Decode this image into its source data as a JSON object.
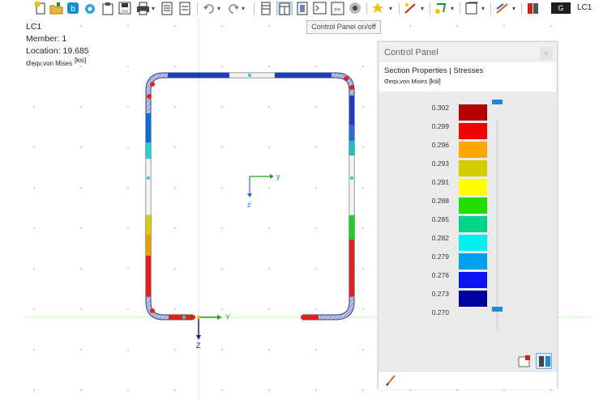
{
  "toolbar": {
    "loadcase_box": "G",
    "loadcase_label": "LC1",
    "icons": [
      "new-file-icon",
      "open-folder-icon",
      "app-icon",
      "gear-cloud-icon",
      "clipboard-icon",
      "save-icon",
      "print-icon",
      "print-dropdown-icon",
      "report-icon",
      "document-icon",
      "undo-icon",
      "redo-icon",
      "table-icon",
      "table-active-icon",
      "section-icon",
      "console-icon",
      "calculator-icon",
      "render-icon",
      "star-icon",
      "member-icon",
      "load-icon",
      "view-box-icon",
      "line-style-icon",
      "book-icon"
    ]
  },
  "info": {
    "loadcase": "LC1",
    "member": "Member: 1",
    "location": "Location: 19.685",
    "stress_symbol": "σ",
    "stress_subscript": "eqv,von Mises",
    "stress_unit": "[ksi]"
  },
  "tooltip": "Control Panel on/off",
  "axes": {
    "y": "y",
    "z": "z",
    "Y": "Y",
    "Z": "Z"
  },
  "control_panel": {
    "title": "Control Panel",
    "close": "×",
    "heading": "Section Properties | Stresses",
    "sub_symbol": "σ",
    "sub_subscript": "eqv,von Mises",
    "sub_unit": "[ksi]",
    "legend": [
      {
        "value": "0.302",
        "color": "#b40000"
      },
      {
        "value": "0.299",
        "color": "#f20000"
      },
      {
        "value": "0.296",
        "color": "#ffa600"
      },
      {
        "value": "0.293",
        "color": "#d5cc00"
      },
      {
        "value": "0.291",
        "color": "#ffff00"
      },
      {
        "value": "0.288",
        "color": "#21de00"
      },
      {
        "value": "0.285",
        "color": "#00d38a"
      },
      {
        "value": "0.282",
        "color": "#00f0f0"
      },
      {
        "value": "0.279",
        "color": "#00a0f0"
      },
      {
        "value": "0.276",
        "color": "#0c14f4"
      },
      {
        "value": "0.273",
        "color": "#00009e"
      },
      {
        "value": "0.270",
        "color": ""
      }
    ]
  },
  "colors": {
    "accent": "#1e8ad6",
    "section_outline": "#5a5a7a",
    "max_stress": "#e61e1e"
  }
}
